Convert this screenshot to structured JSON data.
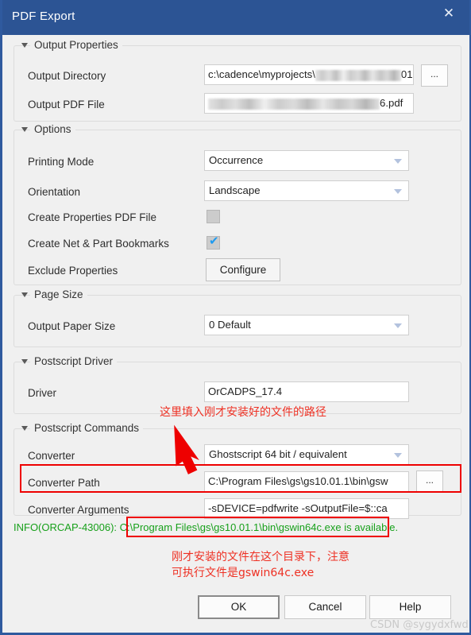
{
  "window": {
    "title": "PDF Export",
    "close_icon": "close-icon",
    "titlebar_color": "#2c5494",
    "accent_border_color": "#2f5a9e"
  },
  "groups": {
    "output_properties": {
      "title": "Output Properties",
      "fields": {
        "output_directory": {
          "label": "Output Directory",
          "value_prefix": "c:\\cadence\\myprojects\\",
          "value_suffix": "01",
          "redacted": true,
          "browse_label": "..."
        },
        "output_pdf_file": {
          "label": "Output PDF File",
          "value_prefix": "",
          "value_suffix": "6.pdf",
          "redacted": true
        }
      }
    },
    "options": {
      "title": "Options",
      "fields": {
        "printing_mode": {
          "label": "Printing Mode",
          "value": "Occurrence"
        },
        "orientation": {
          "label": "Orientation",
          "value": "Landscape"
        },
        "create_properties_pdf": {
          "label": "Create Properties PDF File",
          "checked": false
        },
        "create_bookmarks": {
          "label": "Create Net & Part Bookmarks",
          "checked": true,
          "check_glyph": "✔"
        },
        "exclude_properties": {
          "label": "Exclude Properties",
          "button_label": "Configure"
        }
      }
    },
    "page_size": {
      "title": "Page Size",
      "fields": {
        "output_paper_size": {
          "label": "Output Paper Size",
          "value": "0 Default"
        }
      }
    },
    "postscript_driver": {
      "title": "Postscript Driver",
      "fields": {
        "driver": {
          "label": "Driver",
          "value": "OrCADPS_17.4"
        }
      }
    },
    "postscript_commands": {
      "title": "Postscript Commands",
      "fields": {
        "converter": {
          "label": "Converter",
          "value": "Ghostscript 64 bit / equivalent"
        },
        "converter_path": {
          "label": "Converter Path",
          "value": "C:\\Program Files\\gs\\gs10.01.1\\bin\\gsw",
          "browse_label": "..."
        },
        "converter_arguments": {
          "label": "Converter Arguments",
          "value": "-sDEVICE=pdfwrite -sOutputFile=$::ca"
        }
      }
    }
  },
  "info": {
    "prefix": "INFO(ORCAP-43006): ",
    "path": "C:\\Program Files\\gs\\gs10.01.1\\bin\\gswin64c.exe",
    "suffix": " is available.",
    "color": "#17a01a"
  },
  "buttons": {
    "ok": "OK",
    "cancel": "Cancel",
    "help": "Help"
  },
  "annotations": {
    "color": "#ee3124",
    "box_color": "#ee0000",
    "top_note": "这里填入刚才安装好的文件的路径",
    "bottom_note_line1": "刚才安装的文件在这个目录下，注意",
    "bottom_note_line2": "可执行文件是gswin64c.exe"
  },
  "watermark": "CSDN @sygydxfwd"
}
